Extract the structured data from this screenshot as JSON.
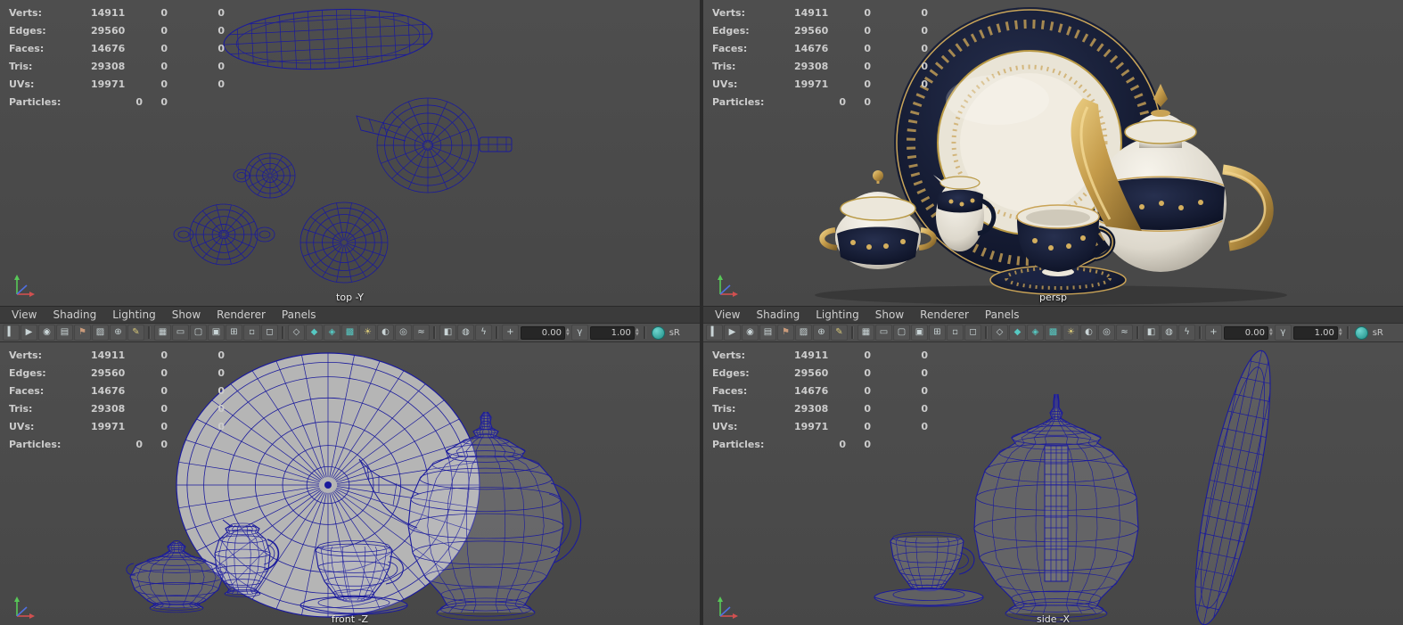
{
  "hud": {
    "rows": [
      {
        "label": "Verts:",
        "v1": "14911",
        "v2": "0",
        "v3": "0"
      },
      {
        "label": "Edges:",
        "v1": "29560",
        "v2": "0",
        "v3": "0"
      },
      {
        "label": "Faces:",
        "v1": "14676",
        "v2": "0",
        "v3": "0"
      },
      {
        "label": "Tris:",
        "v1": "29308",
        "v2": "0",
        "v3": "0"
      },
      {
        "label": "UVs:",
        "v1": "19971",
        "v2": "0",
        "v3": "0"
      },
      {
        "label": "Particles:",
        "v1": "0",
        "v2": "0",
        "v3": ""
      }
    ]
  },
  "panel_menus": [
    "View",
    "Shading",
    "Lighting",
    "Show",
    "Renderer",
    "Panels"
  ],
  "toolbar": {
    "exposure": "0.00",
    "gamma": "1.00",
    "srgb_label": "sR",
    "items": [
      {
        "n": "panel-grip-icon",
        "g": "▍"
      },
      {
        "n": "select-camera-icon",
        "g": "▶"
      },
      {
        "n": "lock-camera-icon",
        "g": "◉"
      },
      {
        "n": "camera-attributes-icon",
        "g": "▤"
      },
      {
        "n": "bookmark-icon",
        "g": "⚑",
        "c": "#c99a7a"
      },
      {
        "n": "image-plane-icon",
        "g": "▨"
      },
      {
        "n": "pan-zoom-2d-icon",
        "g": "⊕"
      },
      {
        "n": "grease-pencil-icon",
        "g": "✎",
        "c": "#d8c878"
      },
      {
        "sep": true
      },
      {
        "n": "grid-icon",
        "g": "▦"
      },
      {
        "n": "film-gate-icon",
        "g": "▭"
      },
      {
        "n": "resolution-gate-icon",
        "g": "▢"
      },
      {
        "n": "gate-mask-icon",
        "g": "▣"
      },
      {
        "n": "field-chart-icon",
        "g": "⊞"
      },
      {
        "n": "safe-action-icon",
        "g": "▫"
      },
      {
        "n": "safe-title-icon",
        "g": "◻"
      },
      {
        "sep": true
      },
      {
        "n": "wireframe-icon",
        "g": "◇"
      },
      {
        "n": "smooth-shade-icon",
        "g": "◆",
        "c": "#56c8c2"
      },
      {
        "n": "wireframe-on-shaded-icon",
        "g": "◈",
        "c": "#56c8c2"
      },
      {
        "n": "textured-icon",
        "g": "▩",
        "c": "#56c8c2"
      },
      {
        "n": "use-all-lights-icon",
        "g": "☀",
        "c": "#d8c878"
      },
      {
        "n": "shadows-icon",
        "g": "◐"
      },
      {
        "n": "ambient-occlusion-icon",
        "g": "◎"
      },
      {
        "n": "motion-blur-icon",
        "g": "≈"
      },
      {
        "sep": true
      },
      {
        "n": "isolate-select-icon",
        "g": "◧"
      },
      {
        "n": "xray-icon",
        "g": "◍"
      },
      {
        "n": "xray-joints-icon",
        "g": "ϟ"
      },
      {
        "sep": true
      },
      {
        "n": "exposure-icon",
        "g": "+"
      },
      {
        "field": "exposure"
      },
      {
        "n": "gamma-icon",
        "g": "γ"
      },
      {
        "field": "gamma"
      },
      {
        "sep": true
      },
      {
        "n": "view-transform-icon",
        "round": true
      },
      {
        "label": "srgb"
      }
    ]
  },
  "viewports": {
    "top": {
      "label": "top -Y"
    },
    "persp": {
      "label": "persp"
    },
    "front": {
      "label": "front -Z"
    },
    "side": {
      "label": "side -X"
    }
  },
  "colors": {
    "wireframe": "#1a1a9c",
    "viewport_bg": "#4a4a4a",
    "menubar_bg": "#3b3b3b",
    "accent_teal": "#3fb5ae",
    "gold": "#c9a356",
    "navy": "#141c33",
    "plate_fill": "#b5b5b5"
  }
}
